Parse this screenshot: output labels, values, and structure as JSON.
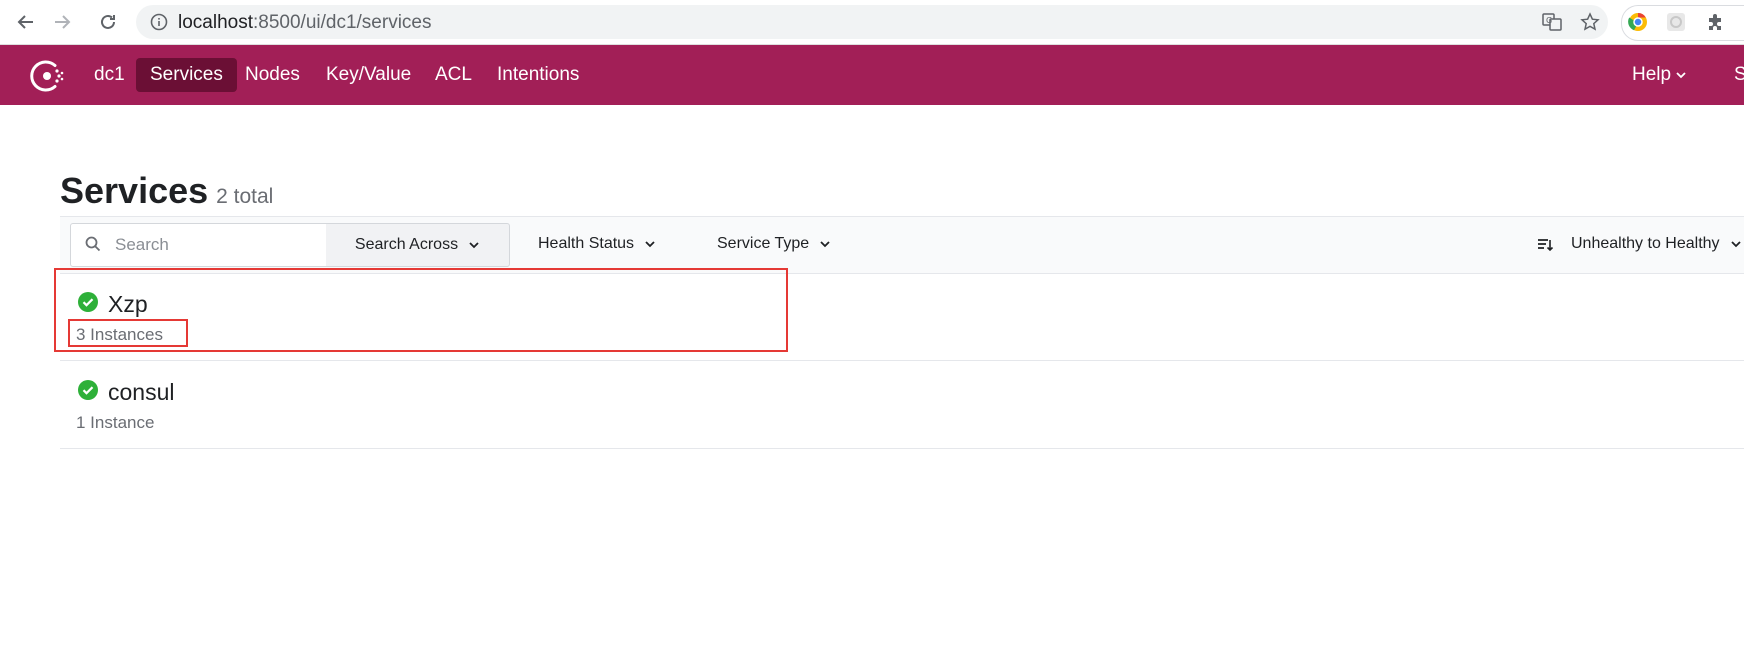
{
  "browser": {
    "url_host": "localhost",
    "url_path": ":8500/ui/dc1/services"
  },
  "header": {
    "datacenter": "dc1",
    "menu": [
      "Services",
      "Nodes",
      "Key/Value",
      "ACL",
      "Intentions"
    ],
    "active": "Services",
    "help_label": "Help",
    "cut_label": "S"
  },
  "page": {
    "title": "Services",
    "total": "2 total"
  },
  "filters": {
    "search_placeholder": "Search",
    "search_across": "Search Across",
    "health_status": "Health Status",
    "service_type": "Service Type",
    "sort": "Unhealthy to Healthy"
  },
  "services": [
    {
      "name": "Xzp",
      "instances": "3 Instances",
      "status": "passing"
    },
    {
      "name": "consul",
      "instances": "1 Instance",
      "status": "passing"
    }
  ],
  "colors": {
    "brand": "#a21f57",
    "active_menu": "#6b0f35",
    "healthy": "#2eb039",
    "highlight": "#e53935"
  }
}
